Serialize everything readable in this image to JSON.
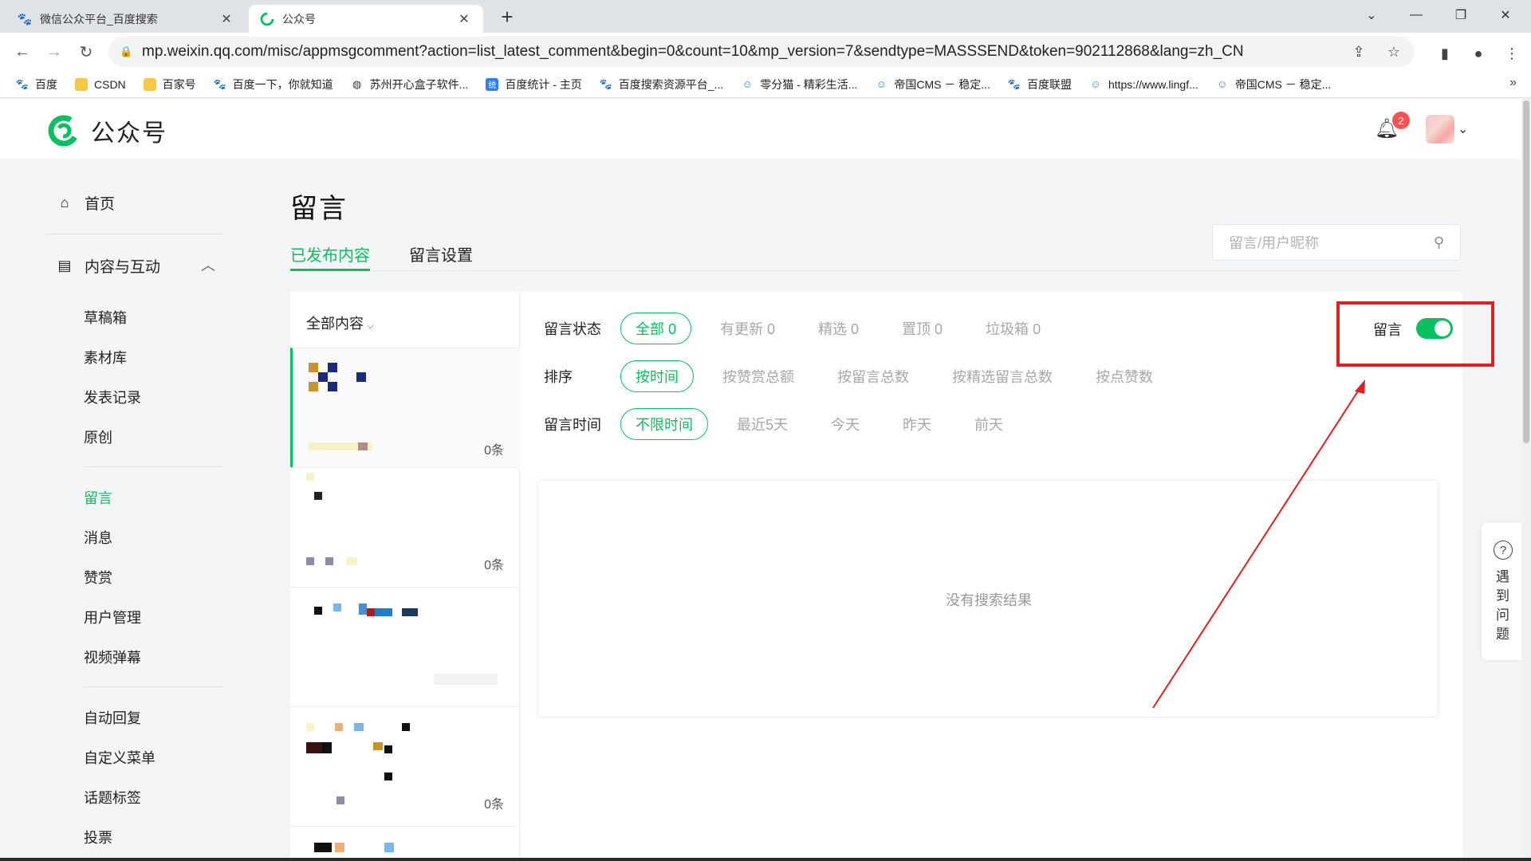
{
  "browser": {
    "tabs": [
      {
        "title": "微信公众平台_百度搜索"
      },
      {
        "title": "公众号"
      }
    ],
    "url": "mp.weixin.qq.com/misc/appmsgcomment?action=list_latest_comment&begin=0&count=10&mp_version=7&sendtype=MASSSEND&token=902112868&lang=zh_CN",
    "bookmarks": [
      {
        "label": "百度",
        "icon": "baidu-paw-icon"
      },
      {
        "label": "CSDN",
        "icon": "folder-icon"
      },
      {
        "label": "百家号",
        "icon": "folder-icon"
      },
      {
        "label": "百度一下，你就知道",
        "icon": "baidu-paw-icon"
      },
      {
        "label": "苏州开心盒子软件...",
        "icon": "globe-icon"
      },
      {
        "label": "百度统计 - 主页",
        "icon": "baidu-stats-icon"
      },
      {
        "label": "百度搜索资源平台_...",
        "icon": "baidu-paw-icon"
      },
      {
        "label": "零分猫 - 精彩生活...",
        "icon": "cat-icon"
      },
      {
        "label": "帝国CMS － 稳定...",
        "icon": "cat-icon"
      },
      {
        "label": "百度联盟",
        "icon": "baidu-paw-icon"
      },
      {
        "label": "https://www.lingf...",
        "icon": "cat-icon"
      },
      {
        "label": "帝国CMS － 稳定...",
        "icon": "cat-icon"
      }
    ]
  },
  "header": {
    "brand": "公众号",
    "notification_count": "2"
  },
  "sidebar": {
    "home": "首页",
    "section": "内容与互动",
    "group1": [
      "草稿箱",
      "素材库",
      "发表记录",
      "原创"
    ],
    "group2": [
      "留言",
      "消息",
      "赞赏",
      "用户管理",
      "视频弹幕"
    ],
    "group3": [
      "自动回复",
      "自定义菜单",
      "话题标签",
      "投票"
    ],
    "active": "留言"
  },
  "main": {
    "title": "留言",
    "tabs": [
      "已发布内容",
      "留言设置"
    ],
    "search_placeholder": "留言/用户昵称",
    "list_header": "全部内容",
    "items": [
      {
        "count": "0条"
      },
      {
        "count": "0条"
      },
      {
        "count": ""
      },
      {
        "count": "0条"
      }
    ],
    "filters": {
      "status": {
        "label": "留言状态",
        "options": [
          "全部 0",
          "有更新 0",
          "精选 0",
          "置顶 0",
          "垃圾箱 0"
        ],
        "selected": 0
      },
      "sort": {
        "label": "排序",
        "options": [
          "按时间",
          "按赞赏总额",
          "按留言总数",
          "按精选留言总数",
          "按点赞数"
        ],
        "selected": 0
      },
      "time": {
        "label": "留言时间",
        "options": [
          "不限时间",
          "最近5天",
          "今天",
          "昨天",
          "前天"
        ],
        "selected": 0
      }
    },
    "comment_toggle": {
      "label": "留言",
      "on": true
    },
    "empty_text": "没有搜索结果"
  },
  "help": {
    "text": "遇到问题"
  },
  "colors": {
    "accent": "#07c160",
    "annotation": "#e02020",
    "badge": "#fa5151"
  }
}
